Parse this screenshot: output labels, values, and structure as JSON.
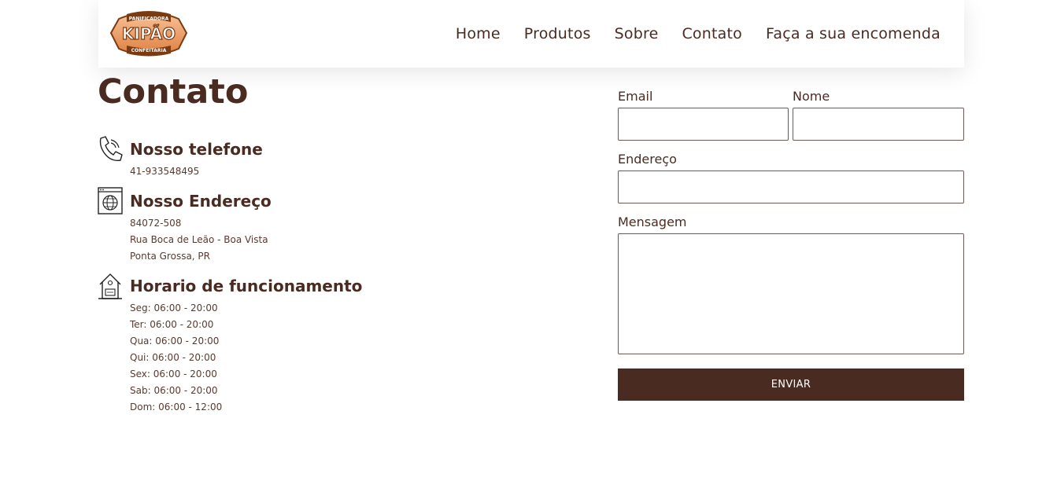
{
  "header": {
    "logo": {
      "top_text": "PANIFICADORA",
      "brand": "KIPÃO",
      "bottom_text": "CONFEITARIA"
    },
    "nav": [
      {
        "label": "Home"
      },
      {
        "label": "Produtos"
      },
      {
        "label": "Sobre"
      },
      {
        "label": "Contato"
      },
      {
        "label": "Faça a sua encomenda"
      }
    ]
  },
  "contact": {
    "title": "Contato",
    "phone": {
      "icon": "phone-icon",
      "heading": "Nosso telefone",
      "lines": [
        "41-933548495"
      ]
    },
    "address": {
      "icon": "web-globe-icon",
      "heading": "Nosso Endereço",
      "lines": [
        "84072-508",
        "Rua Boca de Leão - Boa Vista",
        "Ponta Grossa, PR"
      ]
    },
    "hours": {
      "icon": "house-icon",
      "heading": "Horario de funcionamento",
      "lines": [
        "Seg: 06:00 - 20:00",
        "Ter: 06:00 - 20:00",
        "Qua: 06:00 - 20:00",
        "Qui: 06:00 - 20:00",
        "Sex: 06:00 - 20:00",
        "Sab: 06:00 - 20:00",
        "Dom: 06:00 - 12:00"
      ]
    }
  },
  "form": {
    "email_label": "Email",
    "email_value": "",
    "name_label": "Nome",
    "name_value": "",
    "address_label": "Endereço",
    "address_value": "",
    "message_label": "Mensagem",
    "message_value": "",
    "submit_label": "ENVIAR"
  },
  "colors": {
    "primary_brown": "#4a2b22",
    "logo_orange": "#e8925a",
    "logo_dark": "#7a3b12"
  }
}
